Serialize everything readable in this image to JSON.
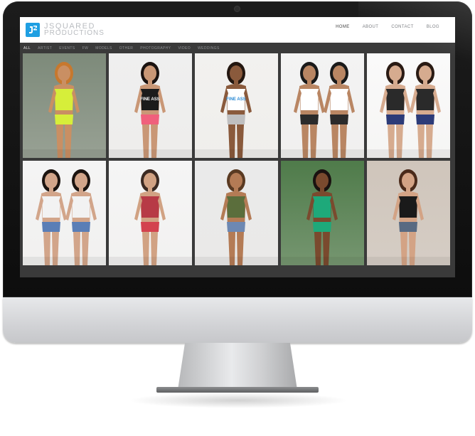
{
  "site": {
    "logo_line1": "JSQUARED",
    "logo_line2": "PRODUCTIONS",
    "brand_color": "#1f9fe2"
  },
  "nav": {
    "items": [
      {
        "label": "HOME",
        "active": true
      },
      {
        "label": "ABOUT",
        "active": false
      },
      {
        "label": "CONTACT",
        "active": false
      },
      {
        "label": "BLOG",
        "active": false
      }
    ]
  },
  "filters": {
    "items": [
      {
        "label": "ALL",
        "active": true
      },
      {
        "label": "ARTIST",
        "active": false
      },
      {
        "label": "EVENTS",
        "active": false
      },
      {
        "label": "FW",
        "active": false
      },
      {
        "label": "MODELS",
        "active": false
      },
      {
        "label": "OTHER",
        "active": false
      },
      {
        "label": "PHOTOGRAPHY",
        "active": false
      },
      {
        "label": "VIDEO",
        "active": false
      },
      {
        "label": "WEDDINGS",
        "active": false
      }
    ]
  },
  "gallery": {
    "tiles": [
      {
        "bg": "#7d8a7a",
        "skin": "#c98f63",
        "top": "#d6ee3a",
        "bottom": "#d6ee3a",
        "hair": "#c7782e"
      },
      {
        "bg": "#efefef",
        "skin": "#c99776",
        "top": "#1b1b1b",
        "bottom": "#f0607c",
        "hair": "#1a1210",
        "shirt_text": "FINE ASS"
      },
      {
        "bg": "#f2f1ef",
        "skin": "#8a5a3c",
        "top": "#ffffff",
        "bottom": "#bfbfc0",
        "hair": "#241710",
        "shirt_text": "FINE ASS"
      },
      {
        "bg": "#f3f3f3",
        "skin": "#b98663",
        "top": "#ffffff",
        "bottom": "#2b2b2b",
        "hair": "#1a1a1a"
      },
      {
        "bg": "#fafafa",
        "skin": "#d6ab8f",
        "top": "#2a2a2a",
        "bottom": "#2c3b78",
        "hair": "#2a1b14"
      },
      {
        "bg": "#f4f4f4",
        "skin": "#d2a58a",
        "top": "#f2f2f2",
        "bottom": "#5a7eb6",
        "hair": "#1c1410"
      },
      {
        "bg": "#f5f5f5",
        "skin": "#d1a283",
        "top": "#b73a46",
        "bottom": "#d3424e",
        "hair": "#3b2a22"
      },
      {
        "bg": "#eaeaea",
        "skin": "#b47b55",
        "top": "#5b6e3c",
        "bottom": "#6d88b2",
        "hair": "#5a3a22"
      },
      {
        "bg": "#4f7b4a",
        "skin": "#7a4a2e",
        "top": "#1ea97a",
        "bottom": "#1ea97a",
        "hair": "#1a1210"
      },
      {
        "bg": "#cfc5bb",
        "skin": "#d3a385",
        "top": "#1a1a1a",
        "bottom": "#586a82",
        "hair": "#4a2a1a"
      }
    ]
  }
}
